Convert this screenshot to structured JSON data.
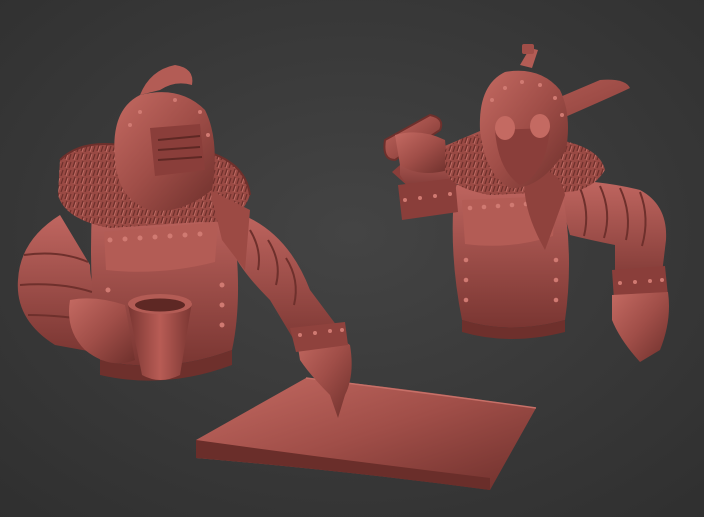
{
  "viewport": {
    "background": "#3a3a3a",
    "material_color": "#a04e48"
  },
  "scene": {
    "figures": [
      {
        "name": "knight-with-mug",
        "props": [
          "mug",
          "map-sheet"
        ]
      },
      {
        "name": "knight-with-sword",
        "props": [
          "sword"
        ]
      }
    ]
  }
}
